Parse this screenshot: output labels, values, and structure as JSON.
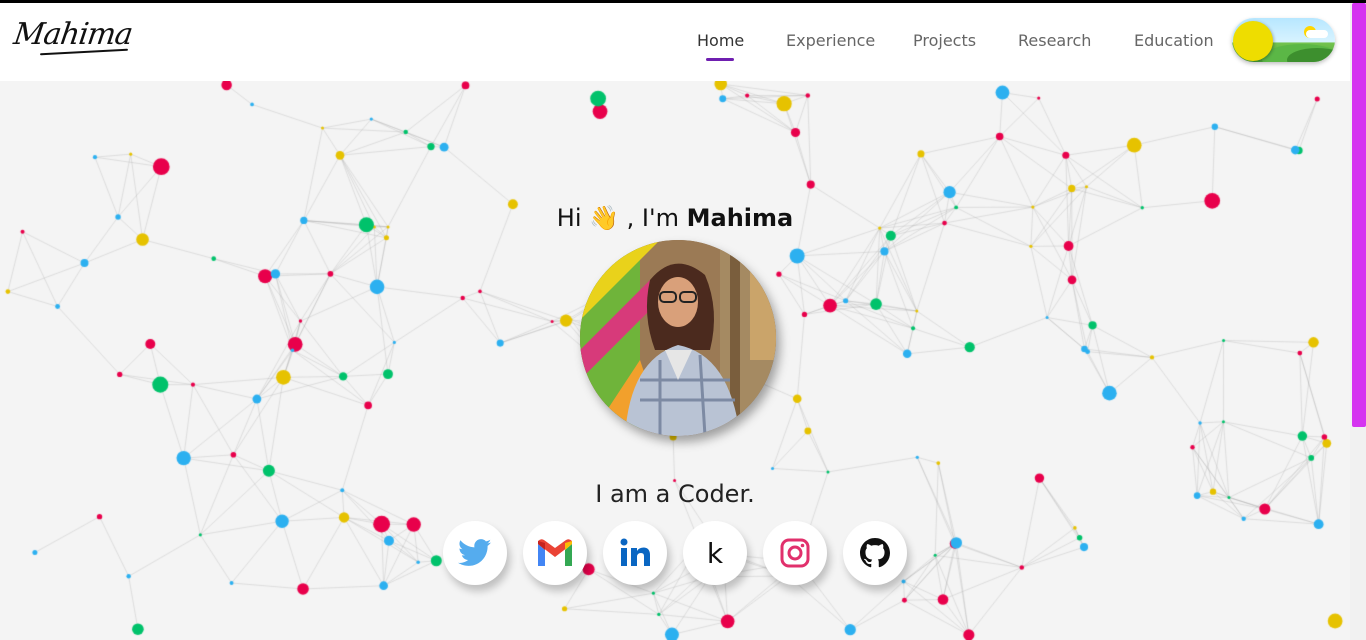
{
  "brand": {
    "logo_text": "Mahima"
  },
  "nav": {
    "items": [
      {
        "label": "Home",
        "active": true
      },
      {
        "label": "Experience",
        "active": false
      },
      {
        "label": "Projects",
        "active": false
      },
      {
        "label": "Research",
        "active": false
      },
      {
        "label": "Education",
        "active": false
      }
    ],
    "theme_toggle": {
      "mode": "light",
      "icon": "sun-icon"
    }
  },
  "hero": {
    "greeting_prefix": "Hi",
    "greeting_emoji": "👋",
    "greeting_middle": ", I'm",
    "name": "Mahima",
    "tagline": "I am a Coder."
  },
  "social_links": [
    {
      "name": "twitter",
      "icon": "twitter-icon",
      "color": "#55acee"
    },
    {
      "name": "gmail",
      "icon": "gmail-icon",
      "color": "#ea4335"
    },
    {
      "name": "linkedin",
      "icon": "linkedin-icon",
      "color": "#0a66c2"
    },
    {
      "name": "kaggle",
      "icon": "kaggle-icon",
      "text": "k",
      "color": "#111111"
    },
    {
      "name": "instagram",
      "icon": "instagram-icon",
      "color": "#e1306c"
    },
    {
      "name": "github",
      "icon": "github-icon",
      "color": "#111111"
    }
  ],
  "colors": {
    "accent": "#6f1fb0",
    "scrollbar": "#d533f0",
    "particles": [
      "#e6c200",
      "#e8004b",
      "#00c26b",
      "#2cb0f0"
    ]
  }
}
